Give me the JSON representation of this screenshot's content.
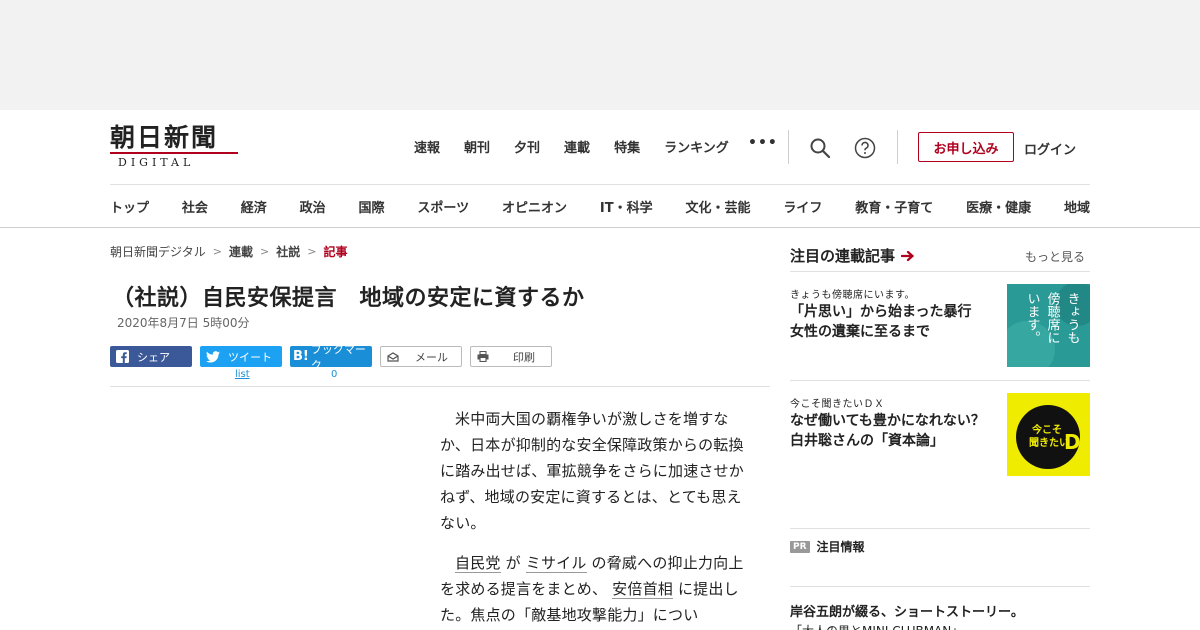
{
  "logo": {
    "kanji": "朝日新聞",
    "sub": "DIGITAL"
  },
  "topnav": [
    "速報",
    "朝刊",
    "夕刊",
    "連載",
    "特集",
    "ランキング"
  ],
  "more_label": "•••",
  "signup_label": "お申し込み",
  "login_label": "ログイン",
  "categories": [
    "トップ",
    "社会",
    "経済",
    "政治",
    "国際",
    "スポーツ",
    "オピニオン",
    "IT・科学",
    "文化・芸能",
    "ライフ",
    "教育・子育て",
    "医療・健康",
    "地域"
  ],
  "breadcrumb": [
    "朝日新聞デジタル",
    "連載",
    "社説",
    "記事"
  ],
  "breadcrumb_sep": ">",
  "article": {
    "headline": "（社説）自民安保提言　地域の安定に資するか",
    "date": "2020年8月7日 5時00分",
    "p1": "米中両大国の覇権争いが激しさを増すなか、日本が抑制的な安全保障政策からの転換に踏み出せば、軍拡競争をさらに加速させかねず、地域の安定に資するとは、とても思えない。",
    "p2_link1": "自民党",
    "p2_t1": " が ",
    "p2_link2": "ミサイル",
    "p2_t2": " の脅威への抑止力向上を求める提言をまとめ、 ",
    "p2_link3": "安倍首相",
    "p2_t3": " に提出した。焦点の「敵基地攻撃能力」につい"
  },
  "share": {
    "facebook": "シェア",
    "twitter": "ツイート",
    "hatena": "ブックマーク",
    "mail": "メール",
    "print": "印刷",
    "twitter_count": "list",
    "hatena_count": "0"
  },
  "sidebar": {
    "title": "注目の連載記事",
    "more": "もっと見る",
    "cards": [
      {
        "series": "きょうも傍聴席にいます。",
        "title": "「片思い」から始まった暴行　女性の遺棄に至るまで",
        "thumb_text": [
          "きょうも",
          "傍聴席に",
          "います。"
        ]
      },
      {
        "series": "今こそ聞きたいＤＸ",
        "title": "なぜ働いても豊かになれない？　白井聡さんの「資本論」",
        "thumb_text": [
          "今こそ",
          "聞きたい",
          "DX"
        ]
      }
    ],
    "pr_badge": "PR",
    "pr_label": "注目情報",
    "pr_title": "岸谷五朗が綴る、ショートストーリー。",
    "pr_sub": "「大人の男とMINI CLUBMAN」"
  },
  "colors": {
    "brand": "#b0001e",
    "facebook": "#3b5998",
    "twitter": "#1da1f2",
    "hatena": "#1a8fd8",
    "dx_yellow": "#f0ec00"
  }
}
